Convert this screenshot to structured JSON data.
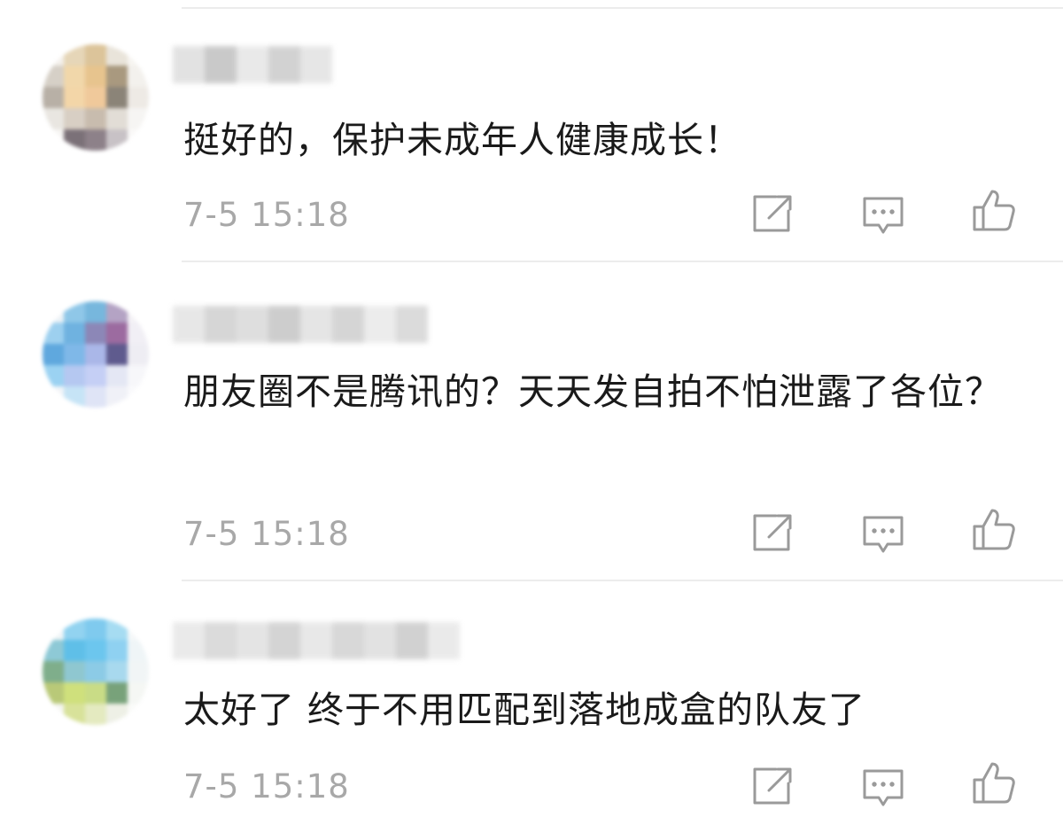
{
  "comments": [
    {
      "text": "挺好的，保护未成年人健康成长！",
      "time": "7-5 15:18"
    },
    {
      "text": "朋友圈不是腾讯的？天天发自拍不怕泄露了各位？",
      "time": "7-5 15:18"
    },
    {
      "text": "太好了 终于不用匹配到落地成盒的队友了",
      "time": "7-5 15:18"
    }
  ],
  "icons": {
    "share": "share-icon",
    "reply": "comment-icon",
    "like": "thumbs-up-icon"
  },
  "colors": {
    "text": "#1a1a1a",
    "meta": "#a8a8a8",
    "icon": "#9a9a9a",
    "divider": "#ececec"
  }
}
